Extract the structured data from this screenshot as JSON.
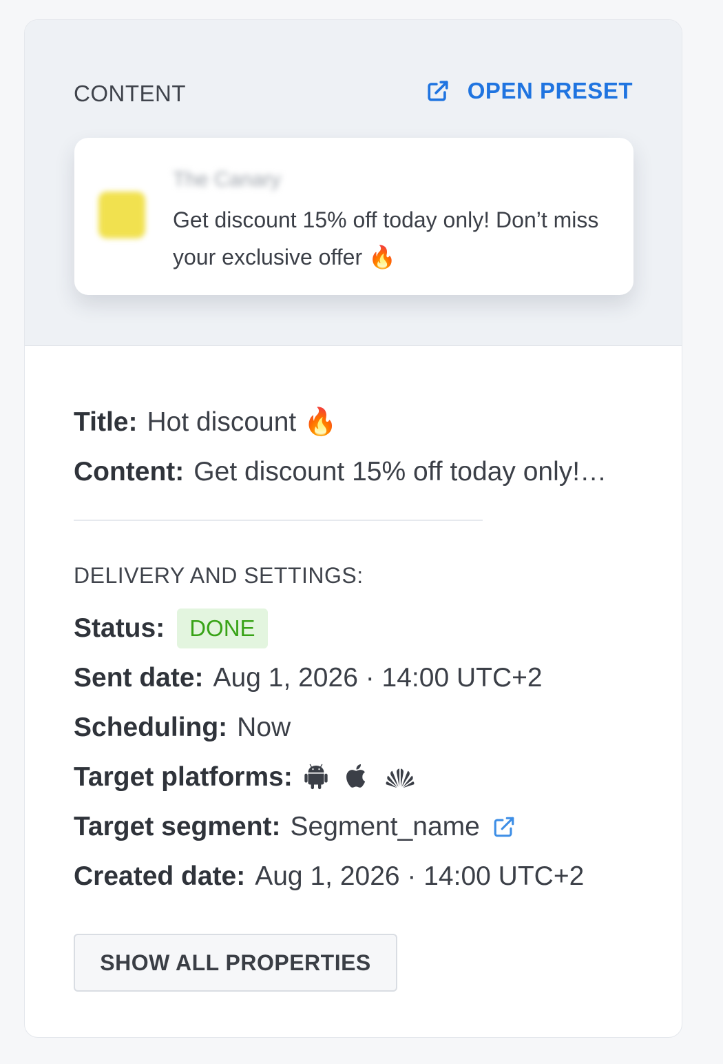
{
  "content_section": {
    "label": "CONTENT",
    "open_preset_label": "OPEN PRESET",
    "accent_color": "#1f74e0",
    "background_color": "#eef1f5"
  },
  "preview": {
    "app_name": "The Canary",
    "message": "Get discount 15% off today only! Don’t miss your exclusive offer 🔥",
    "app_icon_color": "#f1e14f"
  },
  "details": {
    "title_label": "Title:",
    "title_value": "Hot discount 🔥",
    "content_label": "Content:",
    "content_value": "Get discount 15% off today only!…"
  },
  "delivery": {
    "heading": "DELIVERY AND SETTINGS:",
    "status_label": "Status:",
    "status_value": "DONE",
    "status_color": "#38a317",
    "sent_date_label": "Sent date:",
    "sent_date_value": "Aug 1, 2026 · 14:00 UTC+2",
    "scheduling_label": "Scheduling:",
    "scheduling_value": "Now",
    "target_platforms_label": "Target platforms:",
    "target_platforms": [
      "android-icon",
      "apple-icon",
      "huawei-icon"
    ],
    "target_segment_label": "Target segment:",
    "target_segment_value": "Segment_name",
    "created_date_label": "Created date:",
    "created_date_value": "Aug 1, 2026 · 14:00 UTC+2"
  },
  "actions": {
    "show_all_label": "SHOW ALL PROPERTIES"
  }
}
